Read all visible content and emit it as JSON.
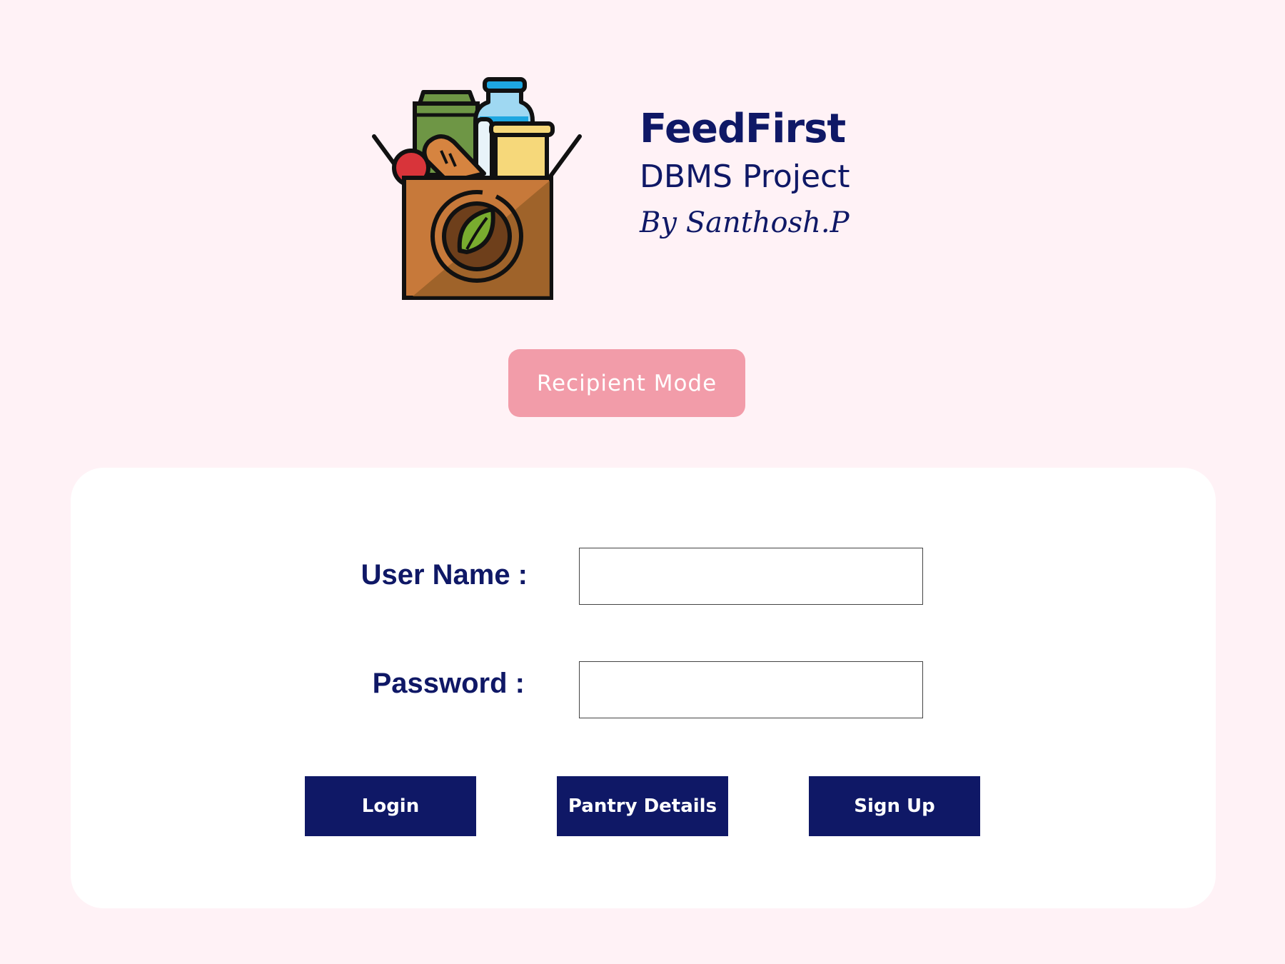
{
  "header": {
    "logo_icon": "grocery-box-icon",
    "app_title": "FeedFirst",
    "subtitle": "DBMS Project",
    "author": "By Santhosh.P"
  },
  "mode_toggle": {
    "label": "Recipient Mode",
    "color": "#f29ca9"
  },
  "login_form": {
    "username_label": "User Name :",
    "username_value": "",
    "password_label": "Password :",
    "password_value": "",
    "buttons": {
      "login": "Login",
      "pantry_details": "Pantry Details",
      "sign_up": "Sign Up"
    }
  },
  "colors": {
    "background": "#fff2f6",
    "primary": "#0f1866",
    "card": "#ffffff",
    "accent": "#f29ca9"
  }
}
